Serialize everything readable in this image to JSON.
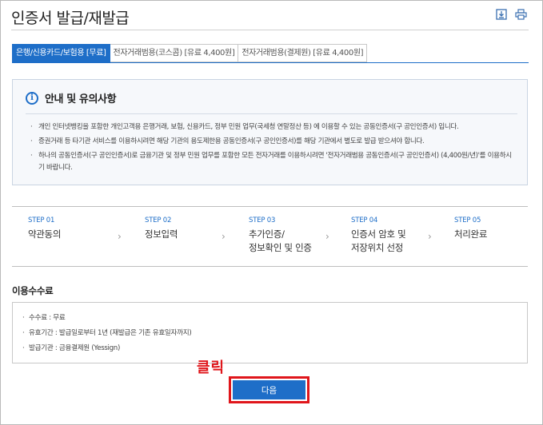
{
  "page": {
    "title": "인증서 발급/재발급",
    "icons": [
      "download-icon",
      "print-icon"
    ]
  },
  "tabs": [
    {
      "label": "은행/신용카드/보험용 [무료]",
      "active": true
    },
    {
      "label": "전자거래범용(코스콤) [유료 4,400원]",
      "active": false
    },
    {
      "label": "전자거래범용(결제원) [유료 4,400원]",
      "active": false
    }
  ],
  "notice": {
    "title": "안내 및 유의사항",
    "items": [
      "개인 인터넷뱅킹을 포함한 개인고객용 은행거래, 보험, 신용카드, 정부 민원 업무(국세청 연말정산 등) 에 이용할 수 있는 공동인증서(구 공인인증서) 입니다.",
      "증권거래 등 타기관 서비스를 이용하시려면 해당 기관의 용도제한용 공동인증서(구 공인인증서)를 해당 기관에서 별도로 발급 받으셔야 합니다.",
      "하나의 공동인증서(구 공인인증서)로 금융기관 및 정부 민원 업무를 포함한 모든 전자거래를 이용하시려면 '전자거래범용 공동인증서(구 공인인증서) (4,400원/년)'를 이용하시기 바랍니다."
    ]
  },
  "steps": [
    {
      "no": "STEP 01",
      "label": "약관동의"
    },
    {
      "no": "STEP 02",
      "label": "정보입력"
    },
    {
      "no": "STEP 03",
      "label": "추가인증/\n정보확인 및 인증"
    },
    {
      "no": "STEP 04",
      "label": "인증서 암호 및\n저장위치 선정"
    },
    {
      "no": "STEP 05",
      "label": "처리완료"
    }
  ],
  "fee": {
    "heading": "이용수수료",
    "items": [
      "수수료 : 무료",
      "유효기간 : 발급일로부터 1년 (재발급은 기존 유효일자까지)",
      "발급기관 : 금융결제원 (Yessign)"
    ]
  },
  "annotation": {
    "text": "클릭",
    "color": "#e0161b"
  },
  "next_button": {
    "label": "다음"
  },
  "colors": {
    "accent": "#1e6ec8",
    "highlight": "#e0161b"
  }
}
